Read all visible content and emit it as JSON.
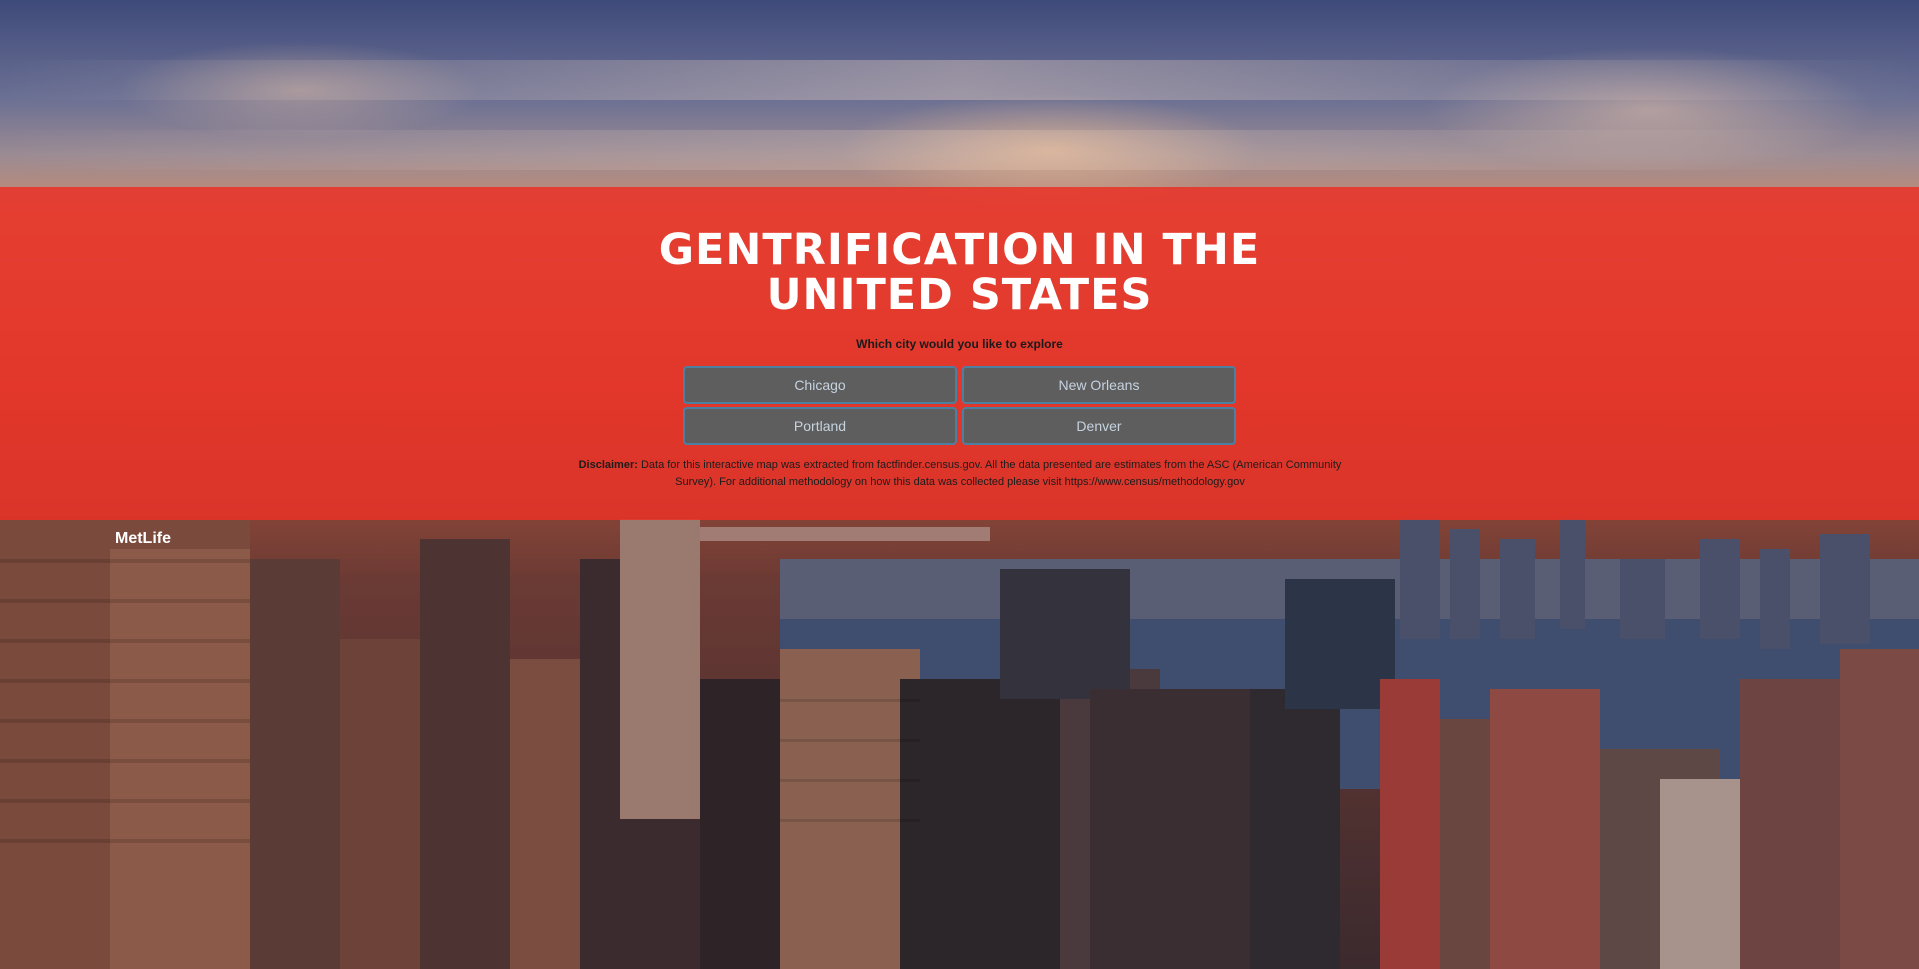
{
  "header": {
    "title_line1": "GENTRIFICATION IN THE",
    "title_line2": "UNITED STATES",
    "prompt": "Which city would you like to explore"
  },
  "cities": [
    {
      "label": "Chicago"
    },
    {
      "label": "New Orleans"
    },
    {
      "label": "Portland"
    },
    {
      "label": "Denver"
    }
  ],
  "disclaimer": {
    "label": "Disclaimer:",
    "text": "Data for this interactive map was extracted from factfinder.census.gov. All the data presented are estimates from the ASC (American Community Survey). For additional methodology on how this data was collected please visit https://www.census/methodology.gov"
  },
  "colors": {
    "banner": "#e93228",
    "button_bg": "#5e5e5e",
    "button_border": "#4f7fa0",
    "button_text": "#c6d3df"
  }
}
